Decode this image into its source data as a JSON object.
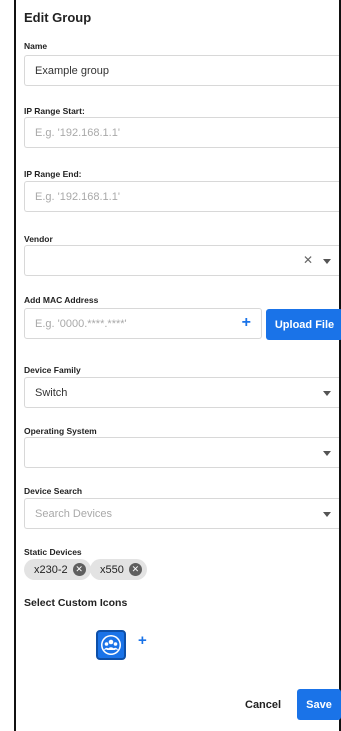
{
  "dialog": {
    "title": "Edit Group"
  },
  "name": {
    "label": "Name",
    "value": "Example group"
  },
  "ip_start": {
    "label": "IP Range Start:",
    "placeholder": "E.g. '192.168.1.1'"
  },
  "ip_end": {
    "label": "IP Range End:",
    "placeholder": "E.g. '192.168.1.1'"
  },
  "vendor": {
    "label": "Vendor",
    "value": "",
    "clear_icon": "close-icon",
    "dropdown_icon": "chevron-down-icon"
  },
  "mac": {
    "label": "Add MAC Address",
    "placeholder": "E.g. '0000.****.****'",
    "add_icon": "plus-icon",
    "upload_label": "Upload File"
  },
  "device_family": {
    "label": "Device Family",
    "value": "Switch"
  },
  "operating_system": {
    "label": "Operating System",
    "value": ""
  },
  "device_search": {
    "label": "Device Search",
    "placeholder": "Search Devices"
  },
  "static_devices": {
    "label": "Static Devices",
    "chips": [
      "x230-2",
      "x550"
    ]
  },
  "custom_icons": {
    "label": "Select Custom Icons",
    "selected_icon": "group-icon",
    "add_icon": "plus-icon"
  },
  "footer": {
    "cancel_label": "Cancel",
    "save_label": "Save"
  },
  "colors": {
    "accent": "#1a73e8",
    "chip_bg": "#e3e3e3",
    "border": "#d8d8d8"
  }
}
